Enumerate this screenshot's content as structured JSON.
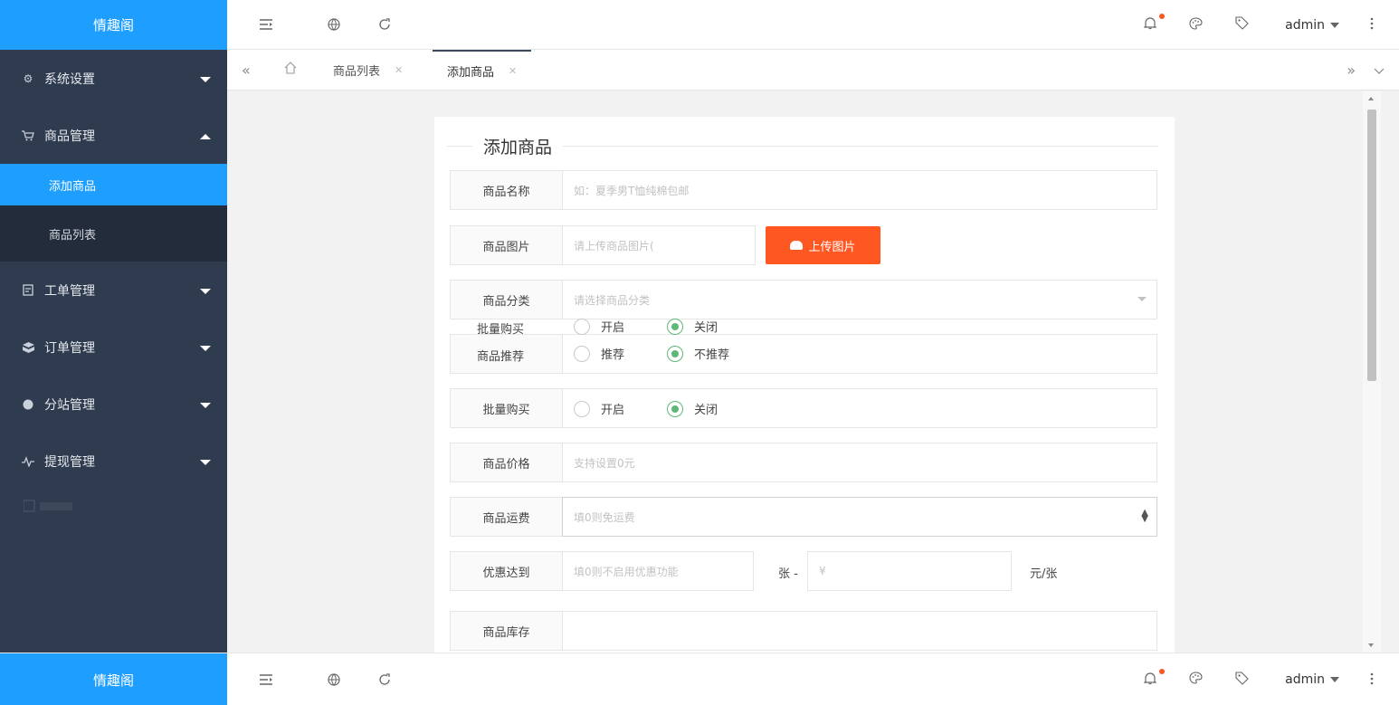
{
  "brand": "情趣阁",
  "sidebar": {
    "menu": [
      {
        "label": "系统设置",
        "icon": "gear-icon"
      },
      {
        "label": "商品管理",
        "icon": "cart-icon"
      },
      {
        "label": "工单管理",
        "icon": "ticket-icon"
      },
      {
        "label": "订单管理",
        "icon": "box-icon"
      },
      {
        "label": "分站管理",
        "icon": "globe-icon"
      },
      {
        "label": "提现管理",
        "icon": "pulse-icon"
      }
    ],
    "submenu": [
      {
        "label": "添加商品"
      },
      {
        "label": "商品列表"
      }
    ]
  },
  "header": {
    "user": "admin"
  },
  "tabs": [
    {
      "label": "商品列表"
    },
    {
      "label": "添加商品"
    }
  ],
  "form": {
    "title": "添加商品",
    "name": {
      "label": "商品名称",
      "placeholder": "如：夏季男T恤纯棉包邮"
    },
    "image": {
      "label": "商品图片",
      "placeholder": "请上传商品图片(",
      "button": "上传图片"
    },
    "category": {
      "label": "商品分类",
      "placeholder": "请选择商品分类"
    },
    "overlap": {
      "bulk_label": "批量购买",
      "bulk_on": "开启",
      "bulk_off": "关闭",
      "rec_label": "商品推荐",
      "rec_on": "推荐",
      "rec_off": "不推荐"
    },
    "bulk": {
      "label": "批量购买",
      "on": "开启",
      "off": "关闭"
    },
    "price": {
      "label": "商品价格",
      "placeholder": "支持设置0元"
    },
    "shipping": {
      "label": "商品运费",
      "placeholder": "填0则免运费"
    },
    "discount": {
      "label": "优惠达到",
      "placeholder": "填0则不启用优惠功能",
      "mid": "张 -",
      "yen": "¥",
      "suffix": "元/张"
    },
    "stock": {
      "label": "商品库存"
    }
  }
}
